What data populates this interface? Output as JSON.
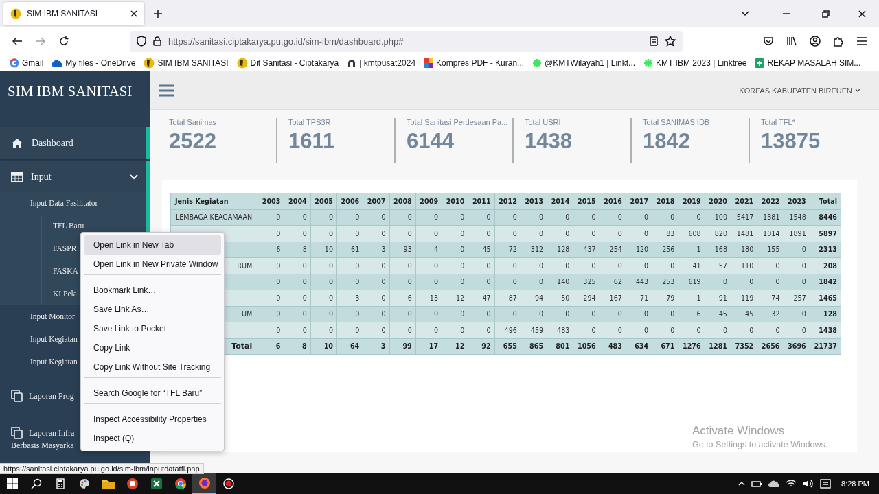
{
  "browser": {
    "tab_title": "SIM IBM SANITASI",
    "url": "https://sanitasi.ciptakarya.pu.go.id/sim-ibm/dashboard.php#",
    "bookmarks": [
      "Gmail",
      "My files - OneDrive",
      "SIM IBM SANITASI",
      "Dit Sanitasi - Ciptakarya",
      "| kmtpusat2024",
      "Kompres PDF - Kuran...",
      "@KMTWilayah1 | Linkt...",
      "KMT IBM 2023 | Linktree",
      "REKAP MASALAH SIM..."
    ]
  },
  "sidebar": {
    "title": "SIM IBM SANITASI",
    "items": [
      {
        "label": "Dashboard",
        "selected": true
      },
      {
        "label": "Input",
        "selected": true,
        "expanded": true,
        "children": [
          {
            "label": "Input Data Fasilitator",
            "children": [
              {
                "label": "TFL Baru"
              },
              {
                "label": "FASPR"
              },
              {
                "label": "FASKA"
              },
              {
                "label": "KI Pela"
              }
            ]
          },
          {
            "label": "Input Monitor"
          },
          {
            "label": "Input Kegiatan"
          },
          {
            "label": "Input Kegiatan"
          }
        ]
      },
      {
        "label": "Laporan Prog",
        "selected": false
      },
      {
        "label": "Laporan Infra Berbasis Masyarka",
        "selected": false
      }
    ]
  },
  "header": {
    "user_menu": "KORFAS KABUPATEN BIREUEN"
  },
  "stats": [
    {
      "label": "Total Sanimas",
      "value": "2522"
    },
    {
      "label": "Total TPS3R",
      "value": "1611"
    },
    {
      "label": "Total Sanitasi Perdesaan Pa...",
      "value": "6144"
    },
    {
      "label": "Total USRI",
      "value": "1438"
    },
    {
      "label": "Total SANIMAS IDB",
      "value": "1842"
    },
    {
      "label": "Total TFL*",
      "value": "13875"
    }
  ],
  "table": {
    "columns": [
      "Jenis Kegiatan",
      "2003",
      "2004",
      "2005",
      "2006",
      "2007",
      "2008",
      "2009",
      "2010",
      "2011",
      "2012",
      "2013",
      "2014",
      "2015",
      "2016",
      "2017",
      "2018",
      "2019",
      "2020",
      "2021",
      "2022",
      "2023",
      "Total"
    ],
    "rows": [
      {
        "kind": "data",
        "label": "LEMBAGA KEAGAMAAN",
        "values": [
          "0",
          "0",
          "0",
          "0",
          "0",
          "0",
          "0",
          "0",
          "0",
          "0",
          "0",
          "0",
          "0",
          "0",
          "0",
          "0",
          "0",
          "100",
          "5417",
          "1381",
          "1548",
          "8446"
        ]
      },
      {
        "kind": "data",
        "values": [
          "0",
          "0",
          "0",
          "0",
          "0",
          "0",
          "0",
          "0",
          "0",
          "0",
          "0",
          "0",
          "0",
          "0",
          "0",
          "83",
          "608",
          "820",
          "1481",
          "1014",
          "1891",
          "5897"
        ]
      },
      {
        "kind": "data",
        "values": [
          "6",
          "8",
          "10",
          "61",
          "3",
          "93",
          "4",
          "0",
          "45",
          "72",
          "312",
          "128",
          "437",
          "254",
          "120",
          "256",
          "1",
          "168",
          "180",
          "155",
          "0",
          "2313"
        ]
      },
      {
        "kind": "data",
        "label": "RUM",
        "values": [
          "0",
          "0",
          "0",
          "0",
          "0",
          "0",
          "0",
          "0",
          "0",
          "0",
          "0",
          "0",
          "0",
          "0",
          "0",
          "0",
          "41",
          "57",
          "110",
          "0",
          "0",
          "208"
        ]
      },
      {
        "kind": "data",
        "values": [
          "0",
          "0",
          "0",
          "0",
          "0",
          "0",
          "0",
          "0",
          "0",
          "0",
          "0",
          "140",
          "325",
          "62",
          "443",
          "253",
          "619",
          "0",
          "0",
          "0",
          "0",
          "1842"
        ]
      },
      {
        "kind": "data",
        "values": [
          "0",
          "0",
          "0",
          "3",
          "0",
          "6",
          "13",
          "12",
          "47",
          "87",
          "94",
          "50",
          "294",
          "167",
          "71",
          "79",
          "1",
          "91",
          "119",
          "74",
          "257",
          "1465"
        ]
      },
      {
        "kind": "data",
        "label": "UM",
        "values": [
          "0",
          "0",
          "0",
          "0",
          "0",
          "0",
          "0",
          "0",
          "0",
          "0",
          "0",
          "0",
          "0",
          "0",
          "0",
          "0",
          "6",
          "45",
          "45",
          "32",
          "0",
          "128"
        ]
      },
      {
        "kind": "data",
        "values": [
          "0",
          "0",
          "0",
          "0",
          "0",
          "0",
          "0",
          "0",
          "0",
          "496",
          "459",
          "483",
          "0",
          "0",
          "0",
          "0",
          "0",
          "0",
          "0",
          "0",
          "0",
          "1438"
        ]
      },
      {
        "kind": "total",
        "label": "Total",
        "values": [
          "6",
          "8",
          "10",
          "64",
          "3",
          "99",
          "17",
          "12",
          "92",
          "655",
          "865",
          "801",
          "1056",
          "483",
          "634",
          "671",
          "1276",
          "1281",
          "7352",
          "2656",
          "3696",
          "21737"
        ]
      }
    ]
  },
  "context_menu": {
    "items": [
      {
        "label": "Open Link in New Tab",
        "selected": true,
        "separator_before": false
      },
      {
        "label": "Open Link in New Private Window",
        "selected": false,
        "separator_before": false
      },
      {
        "label": "Bookmark Link…",
        "selected": false,
        "separator_before": true
      },
      {
        "label": "Save Link As…",
        "selected": false,
        "separator_before": false
      },
      {
        "label": "Save Link to Pocket",
        "selected": false,
        "separator_before": false
      },
      {
        "label": "Copy Link",
        "selected": false,
        "separator_before": false
      },
      {
        "label": "Copy Link Without Site Tracking",
        "selected": false,
        "separator_before": false
      },
      {
        "label": "Search Google for “TFL Baru”",
        "selected": false,
        "separator_before": true
      },
      {
        "label": "Inspect Accessibility Properties",
        "selected": false,
        "separator_before": true
      },
      {
        "label": "Inspect (Q)",
        "selected": false,
        "separator_before": false
      }
    ]
  },
  "status_link": "https://sanitasi.ciptakarya.pu.go.id/sim-ibm/inputdatatfl.php",
  "activation": {
    "title": "Activate Windows",
    "hint": "Go to Settings to activate Windows."
  },
  "taskbar": {
    "time": "8:28 PM"
  }
}
